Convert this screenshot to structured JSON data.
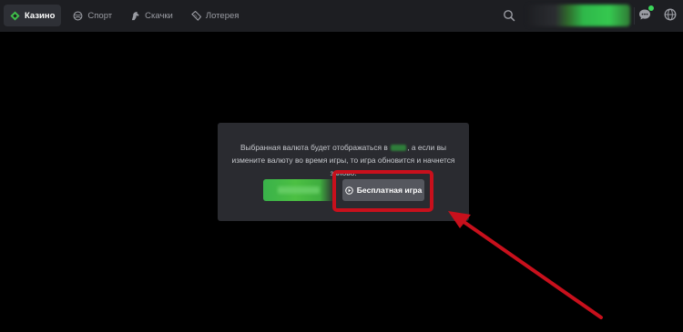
{
  "nav": {
    "items": [
      {
        "label": "Казино",
        "icon": "casino-diamond-icon",
        "active": true
      },
      {
        "label": "Спорт",
        "icon": "ball-icon",
        "active": false
      },
      {
        "label": "Скачки",
        "icon": "horse-icon",
        "active": false
      },
      {
        "label": "Лотерея",
        "icon": "ticket-icon",
        "active": false
      }
    ]
  },
  "header": {
    "search_icon": "search-icon",
    "chat_icon": "chat-icon",
    "language_icon": "globe-icon"
  },
  "modal": {
    "text_before": "Выбранная валюта будет отображаться в",
    "text_after": ", а если вы измените валюту во время игры, то игра обновится и начнется заново.",
    "free_play_label": "Бесплатная игра"
  },
  "colors": {
    "accent_green": "#3fbf4a",
    "highlight_red": "#c8101c",
    "topbar_bg": "#1d1e22",
    "modal_bg": "#2a2b30"
  }
}
